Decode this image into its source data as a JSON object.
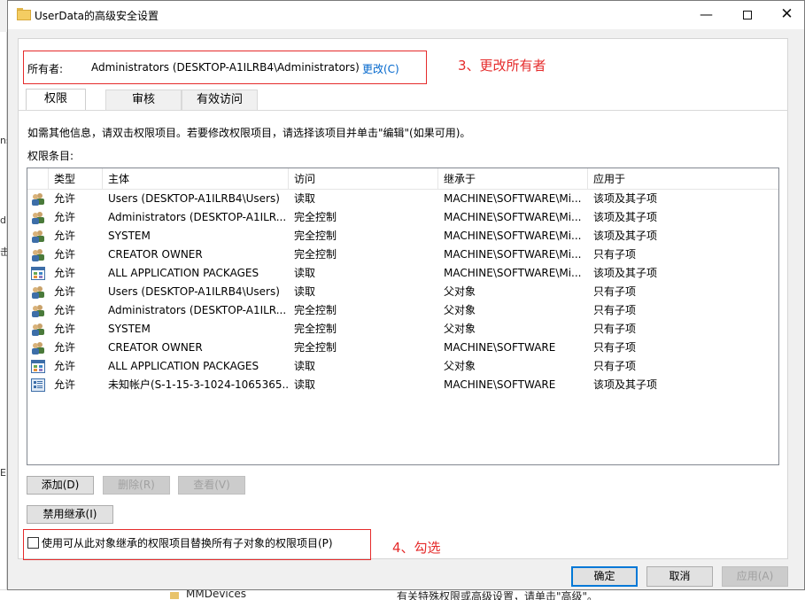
{
  "background": {
    "left_fragments": [
      "ns",
      "d",
      "击",
      "E"
    ],
    "bottom_folder_label": "MMDevices",
    "bottom_text": "有关特殊权限或高级设置，请单击\"高级\"。"
  },
  "window": {
    "title": "UserData的高级安全设置",
    "minimize_label": "—",
    "close_label": "✕"
  },
  "owner": {
    "label": "所有者:",
    "value": "Administrators (DESKTOP-A1ILRB4\\Administrators)",
    "change_link": "更改(C)"
  },
  "annotations": {
    "step3": "3、更改所有者",
    "step4": "4、勾选",
    "color": "#e52b2b"
  },
  "tabs": [
    {
      "label": "权限",
      "active": true
    },
    {
      "label": "审核",
      "active": false
    },
    {
      "label": "有效访问",
      "active": false
    }
  ],
  "info_text": "如需其他信息，请双击权限项目。若要修改权限项目，请选择该项目并单击\"编辑\"(如果可用)。",
  "entries_label": "权限条目:",
  "columns": [
    "类型",
    "主体",
    "访问",
    "继承于",
    "应用于"
  ],
  "rows": [
    {
      "icon": "users-icon",
      "type": "允许",
      "principal": "Users (DESKTOP-A1ILRB4\\Users)",
      "access": "读取",
      "inherited": "MACHINE\\SOFTWARE\\Mi...",
      "applies": "该项及其子项"
    },
    {
      "icon": "users-icon",
      "type": "允许",
      "principal": "Administrators (DESKTOP-A1ILR...",
      "access": "完全控制",
      "inherited": "MACHINE\\SOFTWARE\\Mi...",
      "applies": "该项及其子项"
    },
    {
      "icon": "users-icon",
      "type": "允许",
      "principal": "SYSTEM",
      "access": "完全控制",
      "inherited": "MACHINE\\SOFTWARE\\Mi...",
      "applies": "该项及其子项"
    },
    {
      "icon": "users-icon",
      "type": "允许",
      "principal": "CREATOR OWNER",
      "access": "完全控制",
      "inherited": "MACHINE\\SOFTWARE\\Mi...",
      "applies": "只有子项"
    },
    {
      "icon": "app-packages-icon",
      "type": "允许",
      "principal": "ALL APPLICATION PACKAGES",
      "access": "读取",
      "inherited": "MACHINE\\SOFTWARE\\Mi...",
      "applies": "该项及其子项"
    },
    {
      "icon": "users-icon",
      "type": "允许",
      "principal": "Users (DESKTOP-A1ILRB4\\Users)",
      "access": "读取",
      "inherited": "父对象",
      "applies": "只有子项"
    },
    {
      "icon": "users-icon",
      "type": "允许",
      "principal": "Administrators (DESKTOP-A1ILR...",
      "access": "完全控制",
      "inherited": "父对象",
      "applies": "只有子项"
    },
    {
      "icon": "users-icon",
      "type": "允许",
      "principal": "SYSTEM",
      "access": "完全控制",
      "inherited": "父对象",
      "applies": "只有子项"
    },
    {
      "icon": "users-icon",
      "type": "允许",
      "principal": "CREATOR OWNER",
      "access": "完全控制",
      "inherited": "MACHINE\\SOFTWARE",
      "applies": "只有子项"
    },
    {
      "icon": "app-packages-icon",
      "type": "允许",
      "principal": "ALL APPLICATION PACKAGES",
      "access": "读取",
      "inherited": "父对象",
      "applies": "只有子项"
    },
    {
      "icon": "unknown-account-icon",
      "type": "允许",
      "principal": "未知帐户(S-1-15-3-1024-1065365...",
      "access": "读取",
      "inherited": "MACHINE\\SOFTWARE",
      "applies": "该项及其子项"
    }
  ],
  "buttons": {
    "add": "添加(D)",
    "remove": "删除(R)",
    "view": "查看(V)",
    "disable_inheritance": "禁用继承(I)",
    "ok": "确定",
    "cancel": "取消",
    "apply": "应用(A)"
  },
  "replace_checkbox": {
    "label": "使用可从此对象继承的权限项目替换所有子对象的权限项目(P)",
    "checked": false
  }
}
